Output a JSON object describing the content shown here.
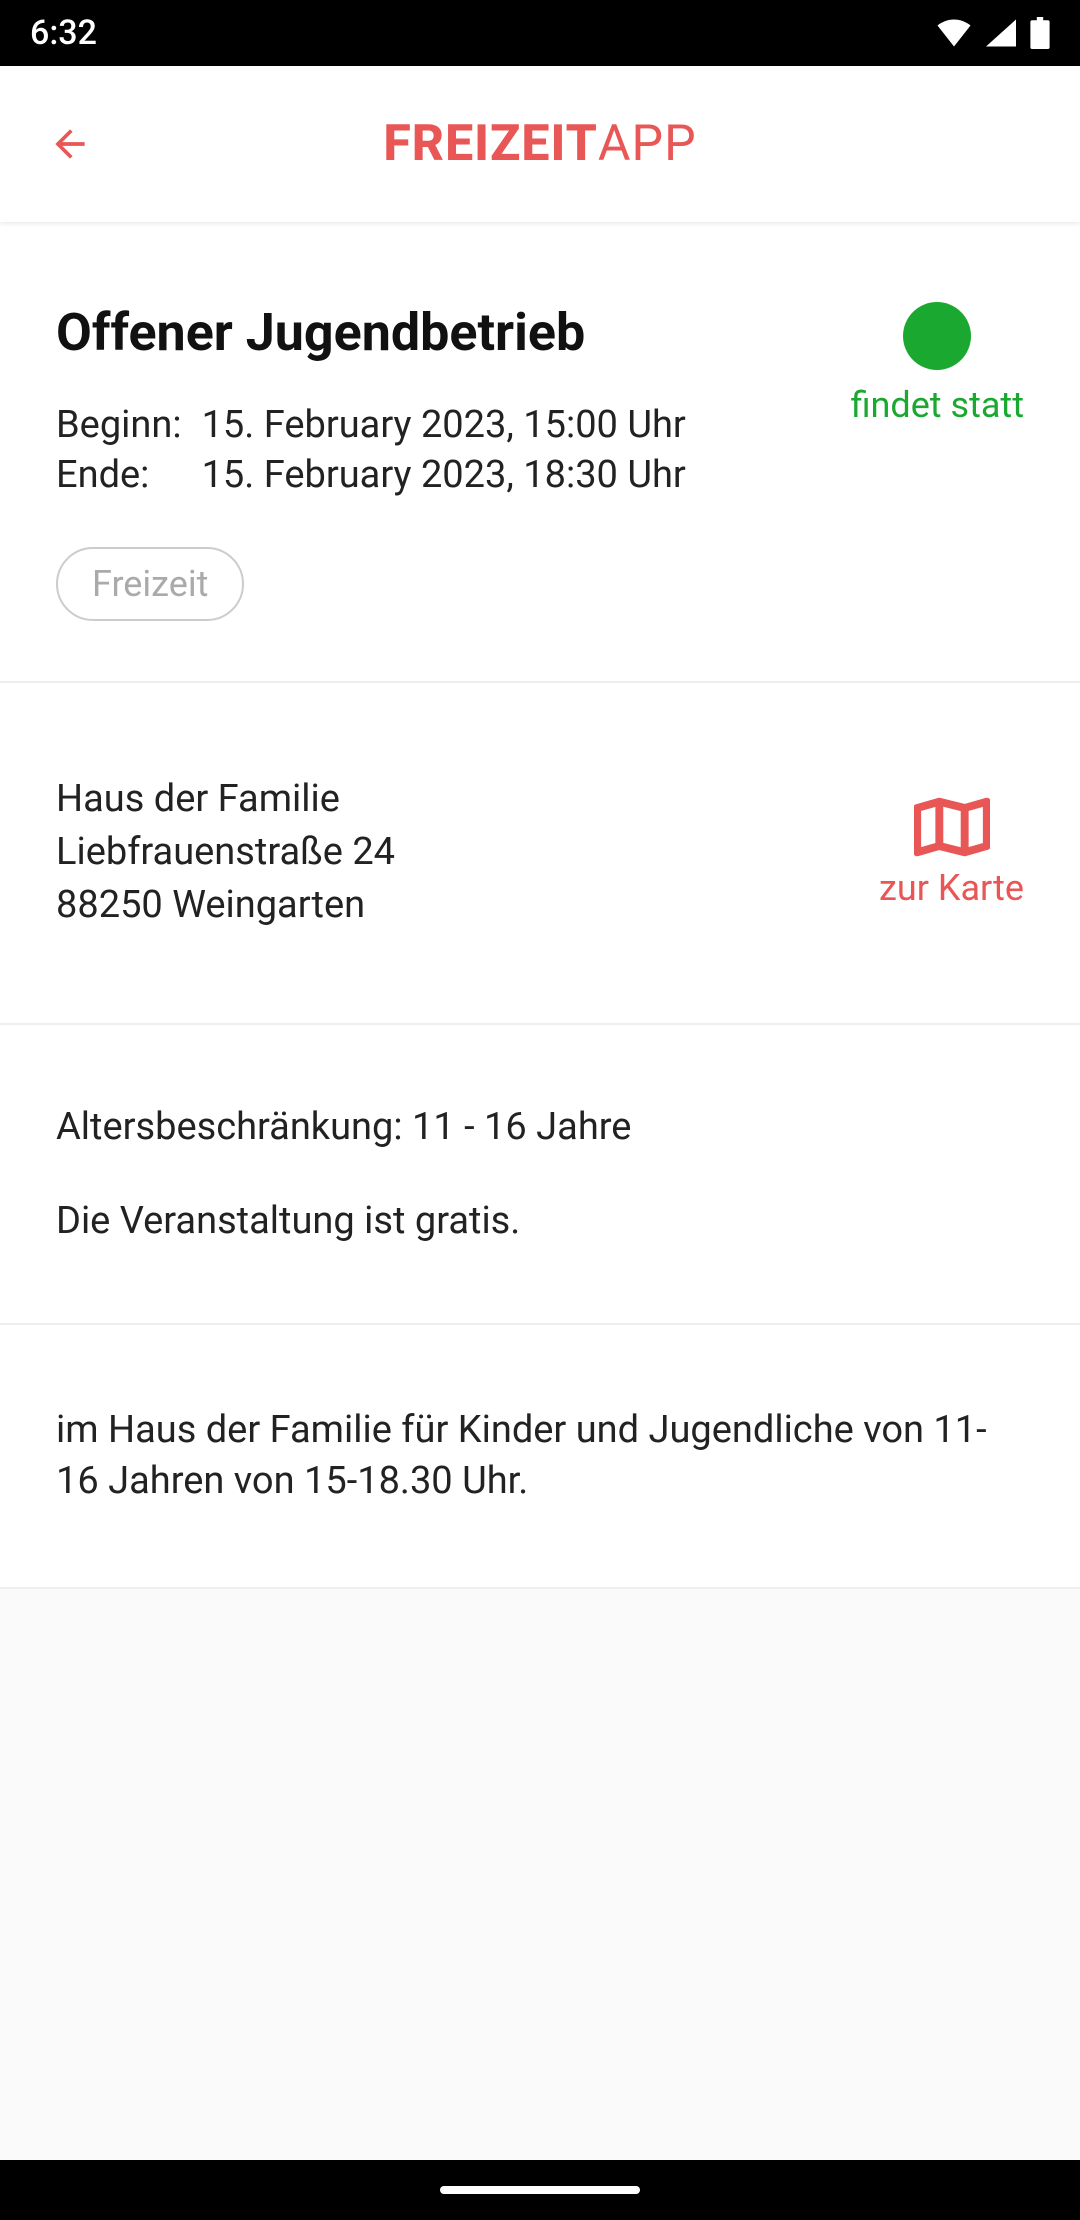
{
  "statusbar": {
    "time": "6:32"
  },
  "header": {
    "title_bold": "FREIZEIT",
    "title_light": "APP"
  },
  "event": {
    "title": "Offener Jugendbetrieb",
    "status_label": "findet statt",
    "begin_label": "Beginn:",
    "begin_value": "15. February 2023, 15:00 Uhr",
    "end_label": "Ende:",
    "end_value": "15. February 2023, 18:30 Uhr",
    "tag": "Freizeit"
  },
  "address": {
    "line1": "Haus der Familie",
    "line2": "Liebfrauenstraße 24",
    "line3": "88250 Weingarten",
    "map_label": "zur Karte"
  },
  "info": {
    "age": "Altersbeschränkung: 11 - 16 Jahre",
    "price": "Die Veranstaltung ist gratis."
  },
  "description": {
    "text": "im Haus der Familie für Kinder und Jugendliche von 11-16 Jahren von 15-18.30 Uhr."
  }
}
